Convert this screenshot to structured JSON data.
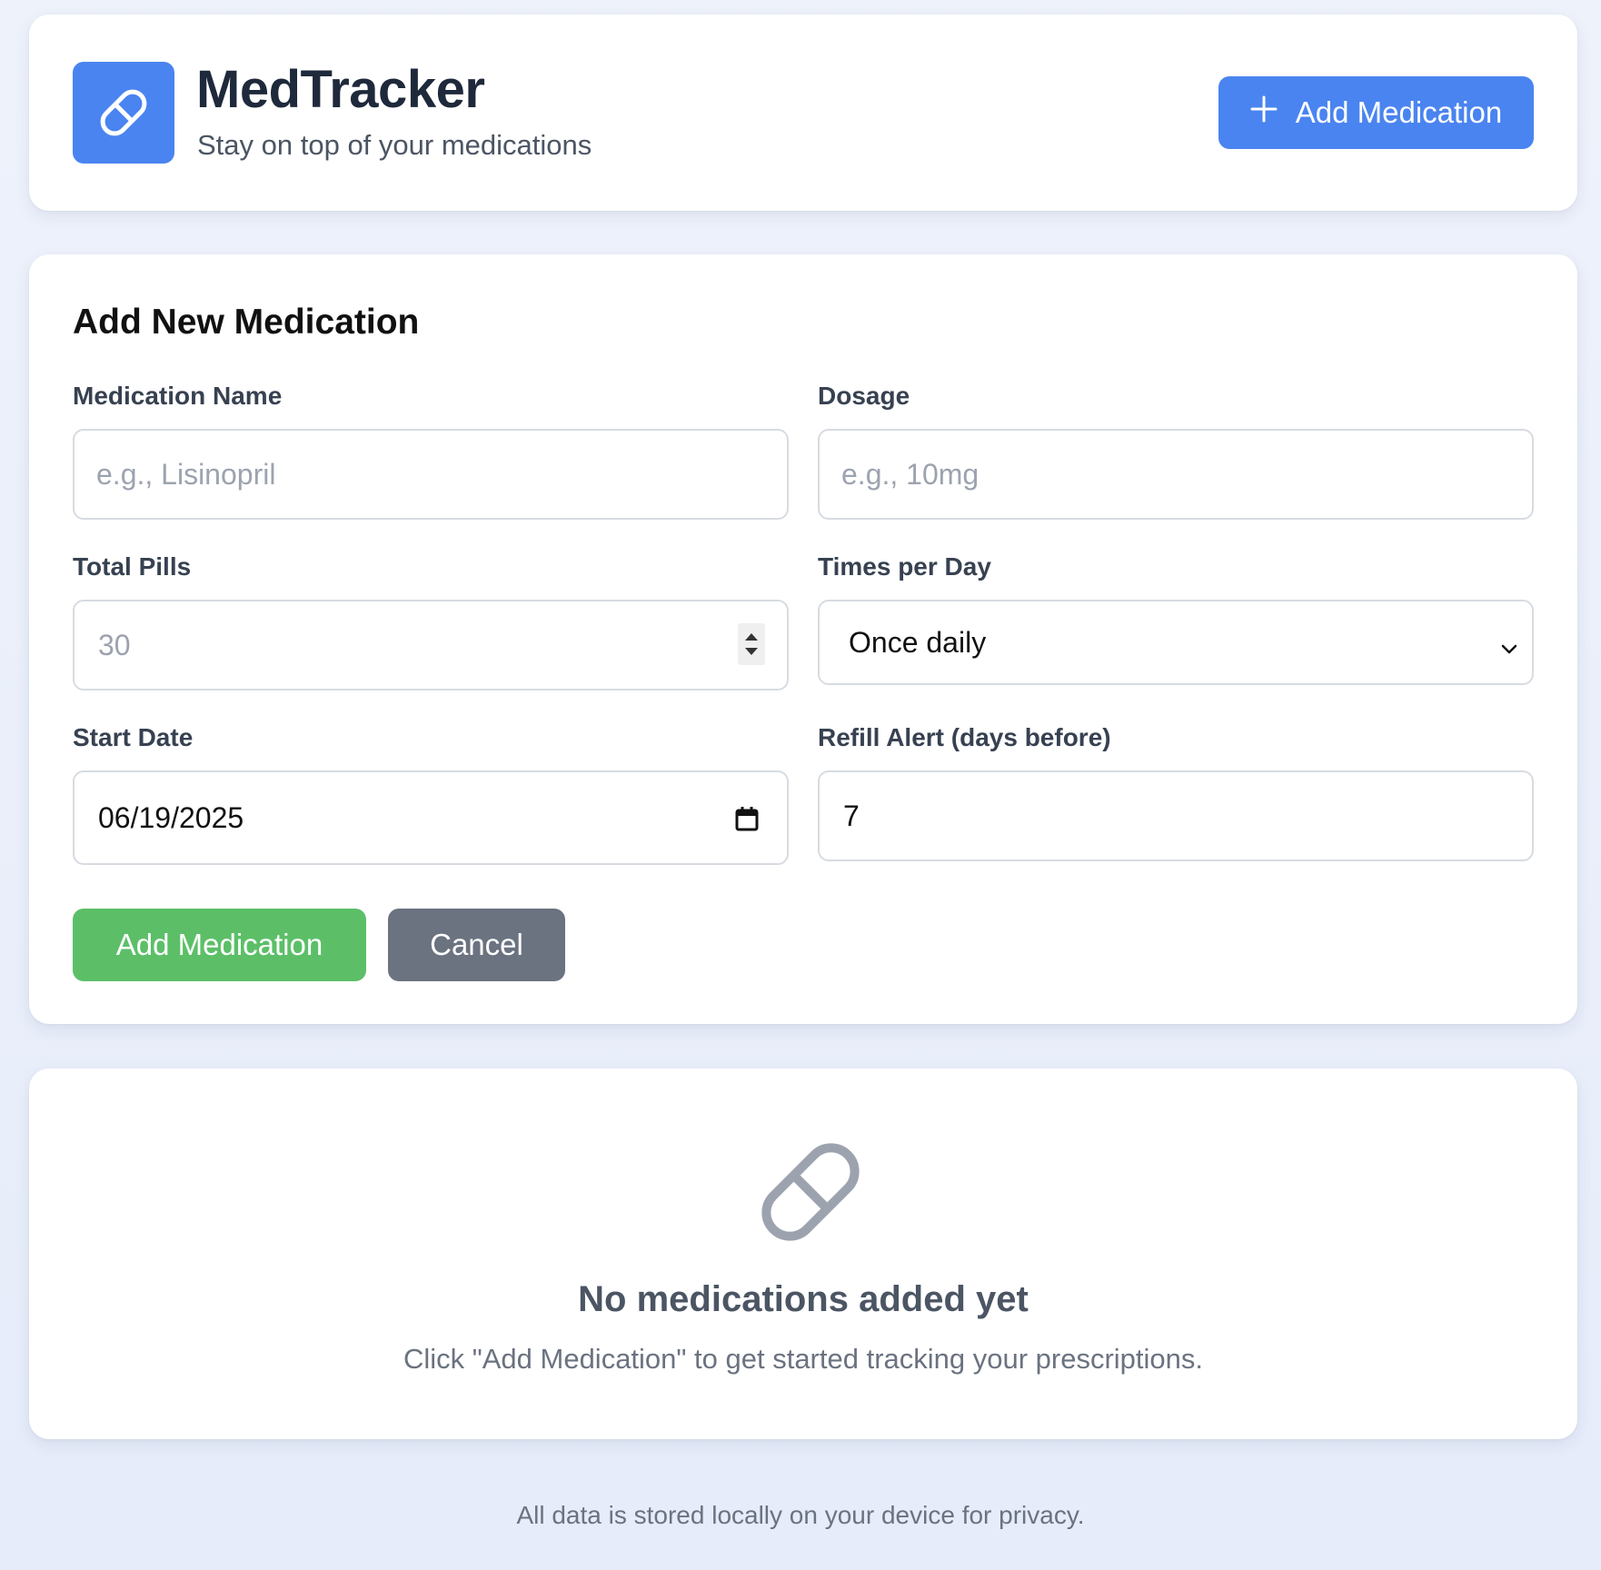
{
  "header": {
    "title": "MedTracker",
    "subtitle": "Stay on top of your medications",
    "add_button_label": "Add Medication",
    "logo_icon": "pill-icon",
    "add_icon": "plus-icon"
  },
  "form": {
    "title": "Add New Medication",
    "fields": {
      "name": {
        "label": "Medication Name",
        "placeholder": "e.g., Lisinopril",
        "value": ""
      },
      "dosage": {
        "label": "Dosage",
        "placeholder": "e.g., 10mg",
        "value": ""
      },
      "total_pills": {
        "label": "Total Pills",
        "placeholder": "30",
        "value": ""
      },
      "times_per_day": {
        "label": "Times per Day",
        "selected": "Once daily"
      },
      "start_date": {
        "label": "Start Date",
        "value": "06/19/2025"
      },
      "refill_alert": {
        "label": "Refill Alert (days before)",
        "value": "7"
      }
    },
    "submit_label": "Add Medication",
    "cancel_label": "Cancel"
  },
  "empty_state": {
    "icon": "pill-icon",
    "title": "No medications added yet",
    "description": "Click \"Add Medication\" to get started tracking your prescriptions."
  },
  "footer": {
    "note": "All data is stored locally on your device for privacy."
  },
  "colors": {
    "primary": "#4a84f0",
    "success": "#5cbf68",
    "secondary": "#6b7280",
    "background": "#eef2fb"
  }
}
